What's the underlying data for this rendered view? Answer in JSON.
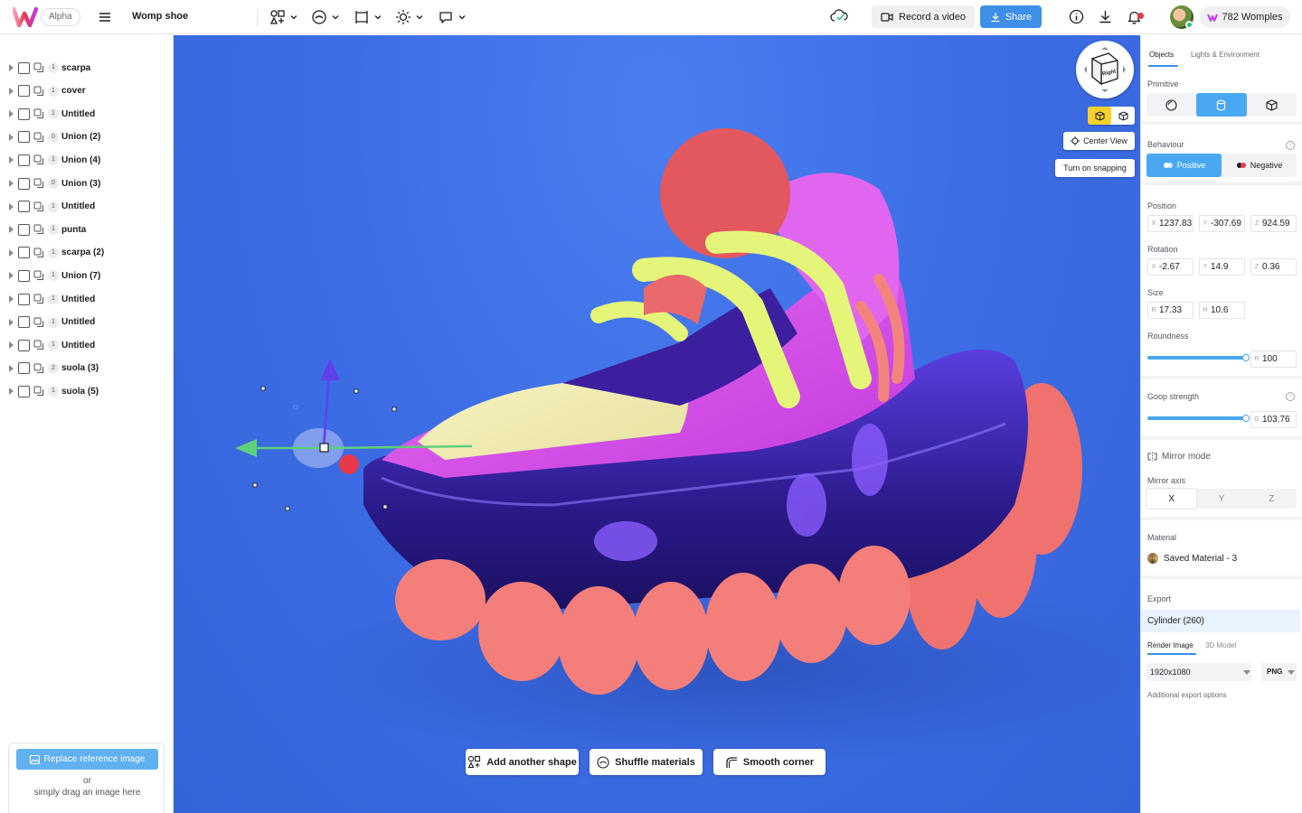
{
  "app": {
    "alpha_badge": "Alpha",
    "document_title": "Womp shoe",
    "brand_color": "#e8394b",
    "accent_color": "#3d8fe8"
  },
  "toolbar": {
    "tools": [
      {
        "icon": "shapes-icon"
      },
      {
        "icon": "material-icon"
      },
      {
        "icon": "frame-icon"
      },
      {
        "icon": "light-icon"
      },
      {
        "icon": "lasso-icon"
      }
    ],
    "record_label": "Record a video",
    "share_label": "Share",
    "womples_label": "782 Womples"
  },
  "scene_tree": [
    {
      "count": "1",
      "label": "scarpa"
    },
    {
      "count": "1",
      "label": "cover"
    },
    {
      "count": "1",
      "label": "Untitled"
    },
    {
      "count": "0",
      "label": "Union (2)"
    },
    {
      "count": "1",
      "label": "Union (4)"
    },
    {
      "count": "0",
      "label": "Union (3)"
    },
    {
      "count": "1",
      "label": "Untitled"
    },
    {
      "count": "1",
      "label": "punta"
    },
    {
      "count": "1",
      "label": "scarpa (2)"
    },
    {
      "count": "1",
      "label": "Union (7)"
    },
    {
      "count": "1",
      "label": "Untitled"
    },
    {
      "count": "1",
      "label": "Untitled"
    },
    {
      "count": "1",
      "label": "Untitled"
    },
    {
      "count": "2",
      "label": "suola (3)"
    },
    {
      "count": "1",
      "label": "suola (5)"
    }
  ],
  "reference": {
    "replace_label": "Replace reference image",
    "or_label": "or",
    "drag_label": "simply drag an image here"
  },
  "viewport": {
    "navcube_face": "Right",
    "center_view_label": "Center View",
    "snapping_label": "Turn on snapping",
    "add_shape_label": "Add another shape",
    "shuffle_label": "Shuffle materials",
    "smooth_corner_label": "Smooth corner"
  },
  "properties": {
    "tabs": [
      "Objects",
      "Lights & Environment"
    ],
    "primitive_label": "Primitive",
    "behaviour_label": "Behaviour",
    "positive_label": "Positive",
    "negative_label": "Negative",
    "position_label": "Position",
    "position": {
      "x": "1237.83",
      "y": "-307.69",
      "z": "924.59"
    },
    "rotation_label": "Rotation",
    "rotation": {
      "x": "-2.67",
      "y": "14.9",
      "z": "0.36"
    },
    "size_label": "Size",
    "size": {
      "r": "17.33",
      "h": "10.6"
    },
    "roundness_label": "Roundness",
    "roundness_value": "100",
    "goop_label": "Goop strength",
    "goop_value": "103.76",
    "mirror_mode_label": "Mirror mode",
    "mirror_axis_label": "Mirror axis",
    "mirror_axes": [
      "X",
      "Y",
      "Z"
    ],
    "material_label": "Material",
    "material_name": "Saved Material - 3",
    "export_label": "Export",
    "export_object": "Cylinder (260)",
    "export_tabs": [
      "Render Image",
      "3D Model"
    ],
    "resolution": "1920x1080",
    "format": "PNG",
    "additional_export": "Additional export options"
  }
}
